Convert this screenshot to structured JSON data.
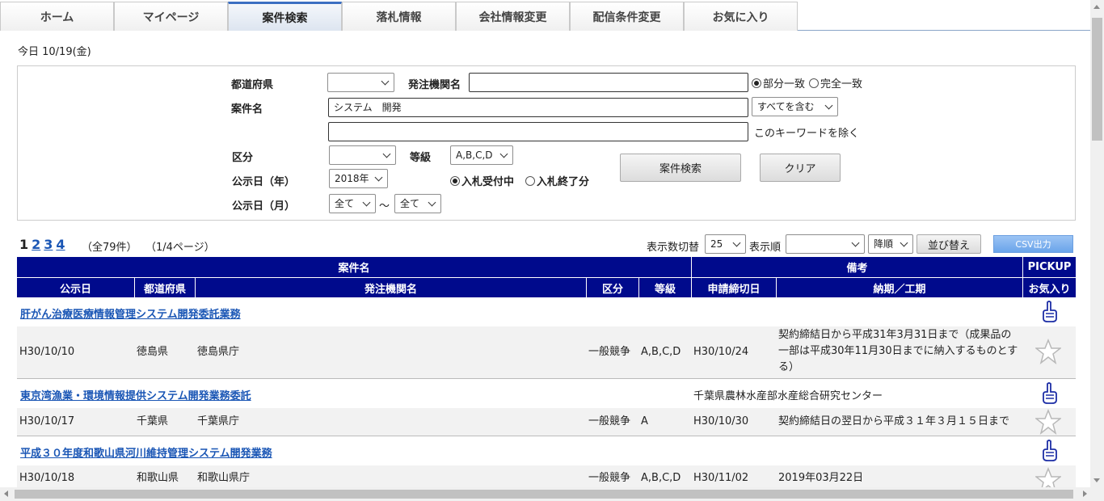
{
  "nav": [
    "ホーム",
    "マイページ",
    "案件検索",
    "落札情報",
    "会社情報変更",
    "配信条件変更",
    "お気に入り"
  ],
  "today": "今日 10/19(金)",
  "search": {
    "pref_label": "都道府県",
    "pref_value": "",
    "agency_label": "発注機関名",
    "agency_value": "",
    "match_partial": "部分一致",
    "match_exact": "完全一致",
    "project_label": "案件名",
    "project_value": "システム　開発",
    "include_mode": "すべてを含む",
    "exclude_value": "",
    "exclude_label": "このキーワードを除く",
    "category_label": "区分",
    "category_value": "",
    "grade_label": "等級",
    "grade_value": "A,B,C,D",
    "year_label": "公示日（年）",
    "year_value": "2018年",
    "status_open": "入札受付中",
    "status_closed": "入札終了分",
    "month_label": "公示日（月）",
    "month_from": "全て",
    "tilde": "～",
    "month_to": "全て",
    "search_button": "案件検索",
    "clear_button": "クリア"
  },
  "pager": {
    "current": "1",
    "pages": [
      "2",
      "3",
      "4"
    ],
    "count": "（全79件）",
    "info": "（1/4ページ）",
    "per_page_label": "表示数切替",
    "per_page_value": "25",
    "order_label": "表示順",
    "order_value": "",
    "direction_value": "降順",
    "sort_button": "並び替え",
    "csv_button": "CSV出力"
  },
  "table": {
    "h_project": "案件名",
    "h_remarks": "備考",
    "h_pickup": "PICKUP",
    "h_date": "公示日",
    "h_pref": "都道府県",
    "h_agency": "発注機関名",
    "h_category": "区分",
    "h_grade": "等級",
    "h_deadline": "申請締切日",
    "h_period": "納期／工期",
    "h_favorite": "お気入り"
  },
  "rows": [
    {
      "title": "肝がん治療医療情報管理システム開発委託業務",
      "extra": "",
      "date": "H30/10/10",
      "pref": "徳島県",
      "agency": "徳島県庁",
      "category": "一般競争",
      "grade": "A,B,C,D",
      "deadline": "H30/10/24",
      "period": "契約締結日から平成31年3月31日まで（成果品の一部は平成30年11月30日までに納入するものとする）"
    },
    {
      "title": "東京湾漁業・環境情報提供システム開発業務委託",
      "extra": "千葉県農林水産部水産総合研究センター",
      "date": "H30/10/17",
      "pref": "千葉県",
      "agency": "千葉県庁",
      "category": "一般競争",
      "grade": "A",
      "deadline": "H30/10/30",
      "period": "契約締結日の翌日から平成３１年３月１５日まで"
    },
    {
      "title": "平成３０年度和歌山県河川維持管理システム開発業務",
      "extra": "",
      "date": "H30/10/18",
      "pref": "和歌山県",
      "agency": "和歌山県庁",
      "category": "一般競争",
      "grade": "A,B,C,D",
      "deadline": "H30/11/02",
      "period": "2019年03月22日"
    }
  ]
}
